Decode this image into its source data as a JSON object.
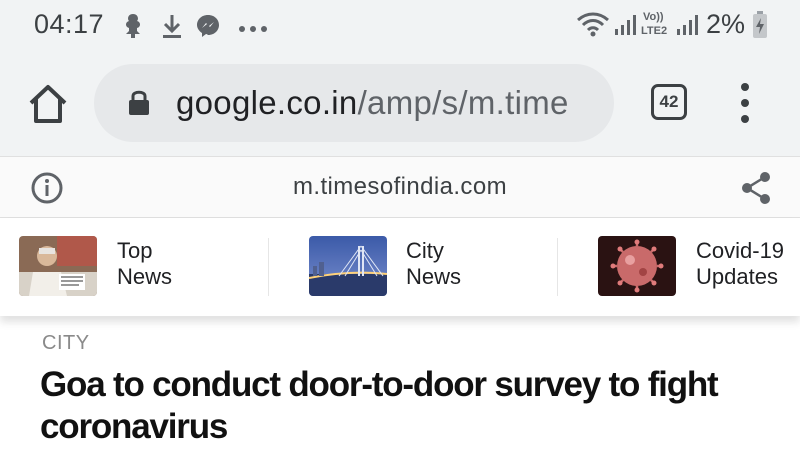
{
  "status_bar": {
    "time": "04:17",
    "notification_icons": [
      "tree-notification-icon",
      "download-icon",
      "messenger-icon",
      "more-notifications-icon"
    ],
    "system_icons": [
      "wifi-icon",
      "signal-icon",
      "volte-lte2-icon",
      "signal-icon"
    ],
    "battery_text": "2%"
  },
  "toolbar": {
    "url_host": "google.co.in",
    "url_path": "/amp/s/m.time",
    "tab_count": "42"
  },
  "amp_header": {
    "domain": "m.timesofindia.com"
  },
  "categories": [
    {
      "label_line1": "Top",
      "label_line2": "News"
    },
    {
      "label_line1": "City",
      "label_line2": "News"
    },
    {
      "label_line1": "Covid-19",
      "label_line2": "Updates"
    }
  ],
  "article": {
    "section": "CITY",
    "headline": "Goa to conduct door-to-door survey to fight coronavirus"
  },
  "colors": {
    "toolbar_bg": "#f1f3f4",
    "omnibox_bg": "#e6e8ea",
    "text_primary": "#202124",
    "text_secondary": "#5f6368"
  }
}
